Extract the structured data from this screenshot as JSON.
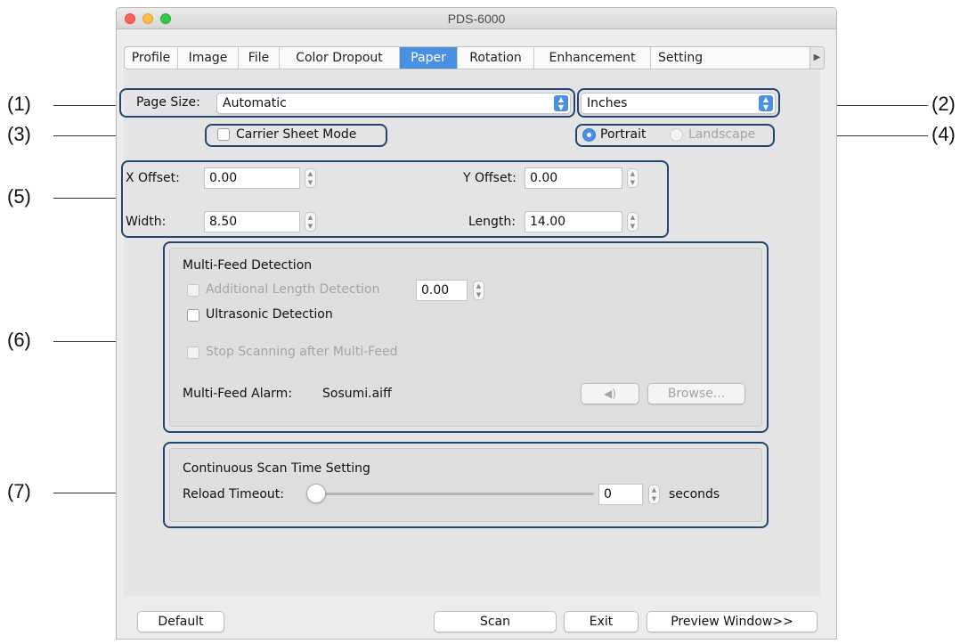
{
  "window": {
    "title": "PDS-6000"
  },
  "tabs": [
    "Profile",
    "Image",
    "File",
    "Color Dropout",
    "Paper",
    "Rotation",
    "Enhancement",
    "Setting"
  ],
  "active_tab": "Paper",
  "page_size": {
    "label": "Page Size:",
    "value": "Automatic"
  },
  "units": {
    "value": "Inches"
  },
  "carrier_sheet": {
    "label": "Carrier Sheet Mode",
    "checked": false
  },
  "orientation": {
    "portrait": "Portrait",
    "landscape": "Landscape",
    "selected": "Portrait"
  },
  "offsets": {
    "x_offset_label": "X Offset:",
    "x_offset": "0.00",
    "y_offset_label": "Y Offset:",
    "y_offset": "0.00",
    "width_label": "Width:",
    "width": "8.50",
    "length_label": "Length:",
    "length": "14.00"
  },
  "multifeed": {
    "title": "Multi-Feed Detection",
    "additional_length_label": "Additional Length Detection",
    "additional_length_value": "0.00",
    "ultrasonic_label": "Ultrasonic Detection",
    "stop_scanning_label": "Stop Scanning after Multi-Feed",
    "alarm_label": "Multi-Feed Alarm:",
    "alarm_file": "Sosumi.aiff",
    "speaker_icon": "speaker-icon",
    "browse_label": "Browse..."
  },
  "continuous": {
    "title": "Continuous Scan Time Setting",
    "reload_label": "Reload Timeout:",
    "reload_value": "0",
    "unit": "seconds",
    "slider_level": 0
  },
  "buttons": {
    "default": "Default",
    "scan": "Scan",
    "exit": "Exit",
    "preview": "Preview Window>>"
  },
  "callouts": [
    "(1)",
    "(2)",
    "(3)",
    "(4)",
    "(5)",
    "(6)",
    "(7)"
  ],
  "colors": {
    "accent": "#4a90e2",
    "callout_border": "#24466e",
    "close": "#fc605c",
    "minimize": "#fdbc40",
    "zoom": "#34c84a"
  }
}
